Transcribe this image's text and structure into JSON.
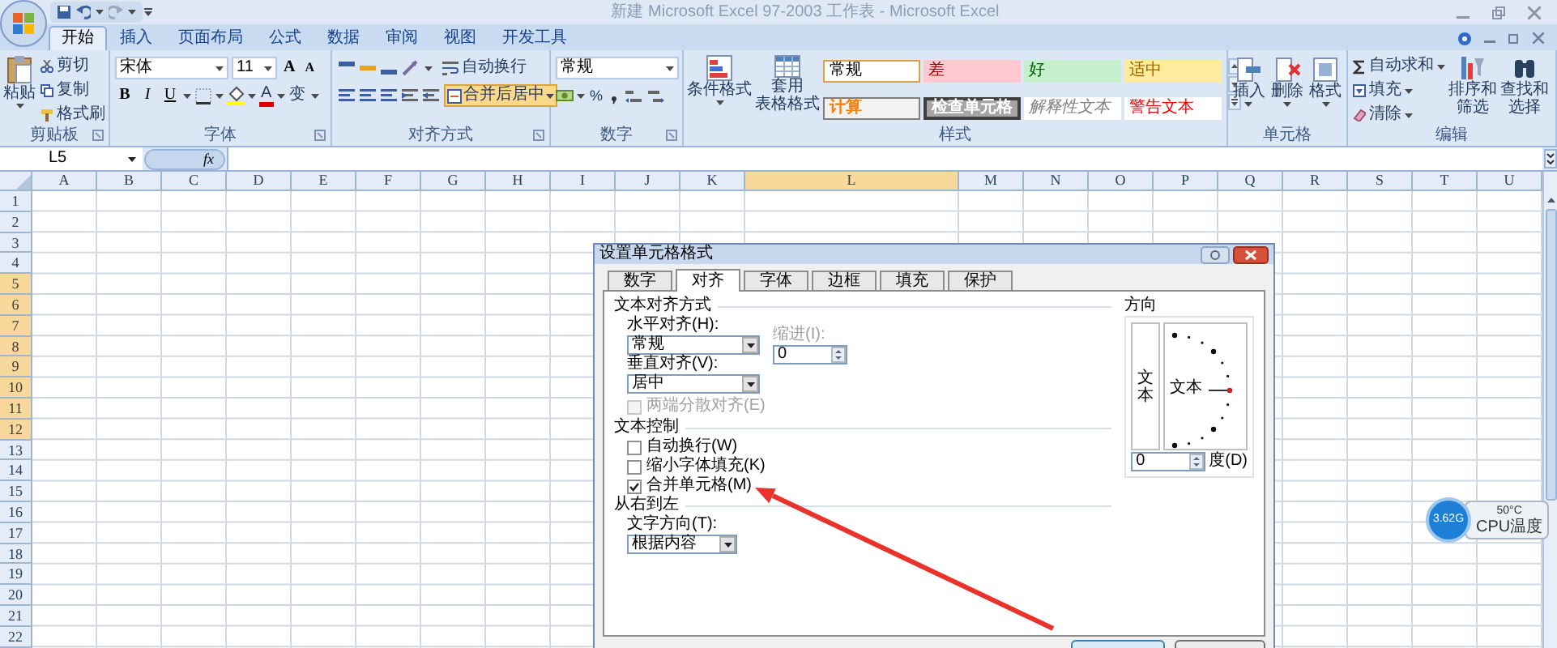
{
  "title_bar": {
    "title": "新建 Microsoft Excel 97-2003 工作表 - Microsoft Excel"
  },
  "ribbon_tabs": [
    {
      "label": "开始",
      "selected": true
    },
    {
      "label": "插入",
      "selected": false
    },
    {
      "label": "页面布局",
      "selected": false
    },
    {
      "label": "公式",
      "selected": false
    },
    {
      "label": "数据",
      "selected": false
    },
    {
      "label": "审阅",
      "selected": false
    },
    {
      "label": "视图",
      "selected": false
    },
    {
      "label": "开发工具",
      "selected": false
    }
  ],
  "ribbon": {
    "clipboard": {
      "paste": "粘贴",
      "cut": "剪切",
      "copy": "复制",
      "format_painter": "格式刷",
      "label": "剪贴板"
    },
    "font": {
      "name": "宋体",
      "size": "11",
      "grow": "A",
      "shrink": "A",
      "bold": "B",
      "italic": "I",
      "underline": "U",
      "font_color": "A",
      "phonetic": "变",
      "label": "字体"
    },
    "alignment": {
      "wrap": "自动换行",
      "merge": "合并后居中",
      "merge_active": true,
      "label": "对齐方式"
    },
    "number": {
      "format": "常规",
      "percent": "%",
      "label": "数字"
    },
    "styles": {
      "conditional": "条件格式",
      "table_format": [
        "套用",
        "表格格式"
      ],
      "gallery": [
        {
          "label": "常规",
          "kind": "normal"
        },
        {
          "label": "差",
          "kind": "bad"
        },
        {
          "label": "好",
          "kind": "good"
        },
        {
          "label": "适中",
          "kind": "neutral"
        },
        {
          "label": "计算",
          "kind": "calc"
        },
        {
          "label": "检查单元格",
          "kind": "check"
        },
        {
          "label": "解释性文本",
          "kind": "explanatory"
        },
        {
          "label": "警告文本",
          "kind": "warning"
        }
      ],
      "label": "样式"
    },
    "cells": {
      "buttons": [
        "插入",
        "删除",
        "格式"
      ],
      "label": "单元格"
    },
    "editing": {
      "autosum": "自动求和",
      "fill": "填充",
      "clear": "清除",
      "sort": [
        "排序和",
        "筛选"
      ],
      "find": [
        "查找和",
        "选择"
      ],
      "label": "编辑"
    }
  },
  "formula_bar": {
    "name_box": "L5",
    "insert_function": "fx"
  },
  "sheet": {
    "columns": [
      {
        "label": "A",
        "selected": false
      },
      {
        "label": "B",
        "selected": false
      },
      {
        "label": "C",
        "selected": false
      },
      {
        "label": "D",
        "selected": false
      },
      {
        "label": "E",
        "selected": false
      },
      {
        "label": "F",
        "selected": false
      },
      {
        "label": "G",
        "selected": false
      },
      {
        "label": "H",
        "selected": false
      },
      {
        "label": "I",
        "selected": false
      },
      {
        "label": "J",
        "selected": false
      },
      {
        "label": "K",
        "selected": false
      },
      {
        "label": "L",
        "selected": true
      },
      {
        "label": "M",
        "selected": false
      },
      {
        "label": "N",
        "selected": false
      },
      {
        "label": "O",
        "selected": false
      },
      {
        "label": "P",
        "selected": false
      },
      {
        "label": "Q",
        "selected": false
      },
      {
        "label": "R",
        "selected": false
      },
      {
        "label": "S",
        "selected": false
      },
      {
        "label": "T",
        "selected": false
      },
      {
        "label": "U",
        "selected": false
      }
    ],
    "rows": [
      {
        "label": "1",
        "selected": false
      },
      {
        "label": "2",
        "selected": false
      },
      {
        "label": "3",
        "selected": false
      },
      {
        "label": "4",
        "selected": false
      },
      {
        "label": "5",
        "selected": true
      },
      {
        "label": "6",
        "selected": true
      },
      {
        "label": "7",
        "selected": true
      },
      {
        "label": "8",
        "selected": true
      },
      {
        "label": "9",
        "selected": true
      },
      {
        "label": "10",
        "selected": true
      },
      {
        "label": "11",
        "selected": true
      },
      {
        "label": "12",
        "selected": true
      },
      {
        "label": "13",
        "selected": false
      },
      {
        "label": "14",
        "selected": false
      },
      {
        "label": "15",
        "selected": false
      },
      {
        "label": "16",
        "selected": false
      },
      {
        "label": "17",
        "selected": false
      },
      {
        "label": "18",
        "selected": false
      },
      {
        "label": "19",
        "selected": false
      },
      {
        "label": "20",
        "selected": false
      },
      {
        "label": "21",
        "selected": false
      },
      {
        "label": "22",
        "selected": false
      }
    ]
  },
  "dialog": {
    "title": "设置单元格格式",
    "tabs": [
      {
        "label": "数字",
        "selected": false
      },
      {
        "label": "对齐",
        "selected": true
      },
      {
        "label": "字体",
        "selected": false
      },
      {
        "label": "边框",
        "selected": false
      },
      {
        "label": "填充",
        "selected": false
      },
      {
        "label": "保护",
        "selected": false
      }
    ],
    "text_alignment": {
      "heading": "文本对齐方式",
      "horizontal_label": "水平对齐(H):",
      "horizontal_value": "常规",
      "indent_label": "缩进(I):",
      "indent_disabled": true,
      "indent_value": "0",
      "vertical_label": "垂直对齐(V):",
      "vertical_value": "居中",
      "distributed": {
        "label": "两端分散对齐(E)",
        "checked": false,
        "disabled": true
      }
    },
    "text_control": {
      "heading": "文本控制",
      "options": [
        {
          "label": "自动换行(W)",
          "checked": false
        },
        {
          "label": "缩小字体填充(K)",
          "checked": false
        },
        {
          "label": "合并单元格(M)",
          "checked": true
        }
      ]
    },
    "rtl": {
      "heading": "从右到左",
      "direction_label": "文字方向(T):",
      "direction_value": "根据内容"
    },
    "orientation": {
      "heading": "方向",
      "vertical_text": "文本",
      "text": "文本",
      "degrees": "0",
      "degrees_label": "度(D)"
    }
  },
  "cpu_widget": {
    "speed": "3.62G",
    "temperature": "50°C",
    "label": "CPU温度"
  }
}
